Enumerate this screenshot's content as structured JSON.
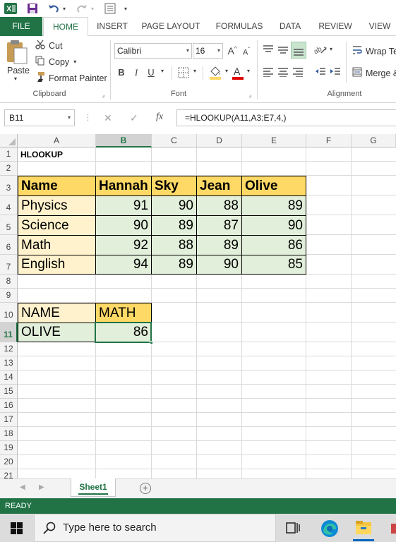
{
  "qat": {
    "excel_logo": "excel-icon",
    "save": "save-icon",
    "undo": "undo-icon",
    "redo": "redo-icon",
    "form": "form-icon",
    "customize": "customize-icon"
  },
  "tabs": [
    "FILE",
    "HOME",
    "INSERT",
    "PAGE LAYOUT",
    "FORMULAS",
    "DATA",
    "REVIEW",
    "VIEW"
  ],
  "active_tab": "HOME",
  "ribbon": {
    "clipboard": {
      "paste": "Paste",
      "cut": "Cut",
      "copy": "Copy",
      "format_painter": "Format Painter",
      "label": "Clipboard"
    },
    "font": {
      "name": "Calibri",
      "size": "16",
      "bold": "B",
      "italic": "I",
      "underline": "U",
      "grow": "A",
      "shrink": "A",
      "font_color": "A",
      "label": "Font"
    },
    "alignment": {
      "wrap": "Wrap Te",
      "merge": "Merge &",
      "label": "Alignment"
    }
  },
  "formula_bar": {
    "name_box": "B11",
    "cancel": "✕",
    "enter": "✓",
    "fx": "fx",
    "formula": "=HLOOKUP(A11,A3:E7,4,)"
  },
  "columns": [
    "A",
    "B",
    "C",
    "D",
    "E",
    "F",
    "G"
  ],
  "selected_column": "B",
  "rows": [
    "1",
    "2",
    "3",
    "4",
    "5",
    "6",
    "7",
    "8",
    "9",
    "10",
    "11",
    "12",
    "13",
    "14",
    "15",
    "16",
    "17",
    "18",
    "19",
    "20",
    "21"
  ],
  "selected_row": "11",
  "cells": {
    "A1": "HLOOKUP",
    "A3": "Name",
    "B3": "Hannah",
    "C3": "Sky",
    "D3": "Jean",
    "E3": "Olive",
    "A4": "Physics",
    "B4": "91",
    "C4": "90",
    "D4": "88",
    "E4": "89",
    "A5": "Science",
    "B5": "90",
    "C5": "89",
    "D5": "87",
    "E5": "90",
    "A6": "Math",
    "B6": "92",
    "C6": "88",
    "D6": "89",
    "E6": "86",
    "A7": "English",
    "B7": "94",
    "C7": "89",
    "D7": "90",
    "E7": "85",
    "A10": "NAME",
    "B10": "MATH",
    "A11": "OLIVE",
    "B11": "86"
  },
  "colors": {
    "excel_green": "#217346",
    "header_fill": "#ffd966",
    "subject_fill": "#fff2cc",
    "value_fill": "#e2efda"
  },
  "sheet": {
    "name": "Sheet1",
    "add": "+"
  },
  "status": "READY",
  "taskbar": {
    "search_placeholder": "Type here to search"
  }
}
